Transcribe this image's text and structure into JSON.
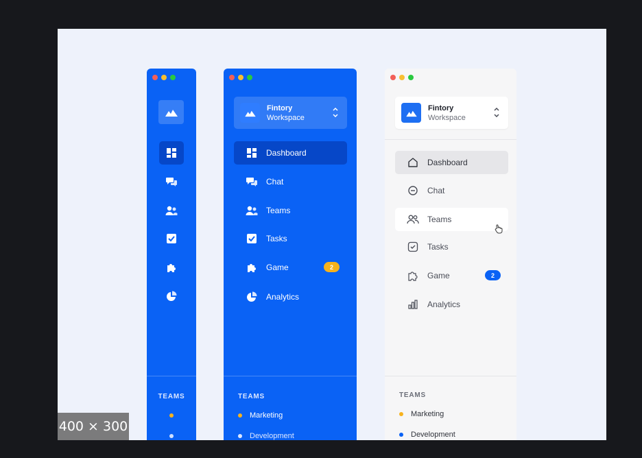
{
  "overlay": {
    "size_badge": "400 × 300"
  },
  "workspace": {
    "name": "Fintory",
    "subtitle": "Workspace"
  },
  "nav": [
    {
      "label": "Dashboard",
      "icon": "dashboard-icon"
    },
    {
      "label": "Chat",
      "icon": "chat-icon"
    },
    {
      "label": "Teams",
      "icon": "teams-icon"
    },
    {
      "label": "Tasks",
      "icon": "tasks-icon"
    },
    {
      "label": "Game",
      "icon": "game-icon",
      "badge": "2"
    },
    {
      "label": "Analytics",
      "icon": "analytics-icon"
    }
  ],
  "teams": {
    "heading": "TEAMS",
    "items": [
      {
        "label": "Marketing",
        "color": "#f7b21d"
      },
      {
        "label": "Development",
        "color": "#0a62f5"
      }
    ]
  },
  "colors": {
    "brand_blue": "#0a62f5",
    "active_blue": "#0647c8",
    "badge_yellow": "#f7b21d",
    "light_bg": "#f6f6f7"
  }
}
